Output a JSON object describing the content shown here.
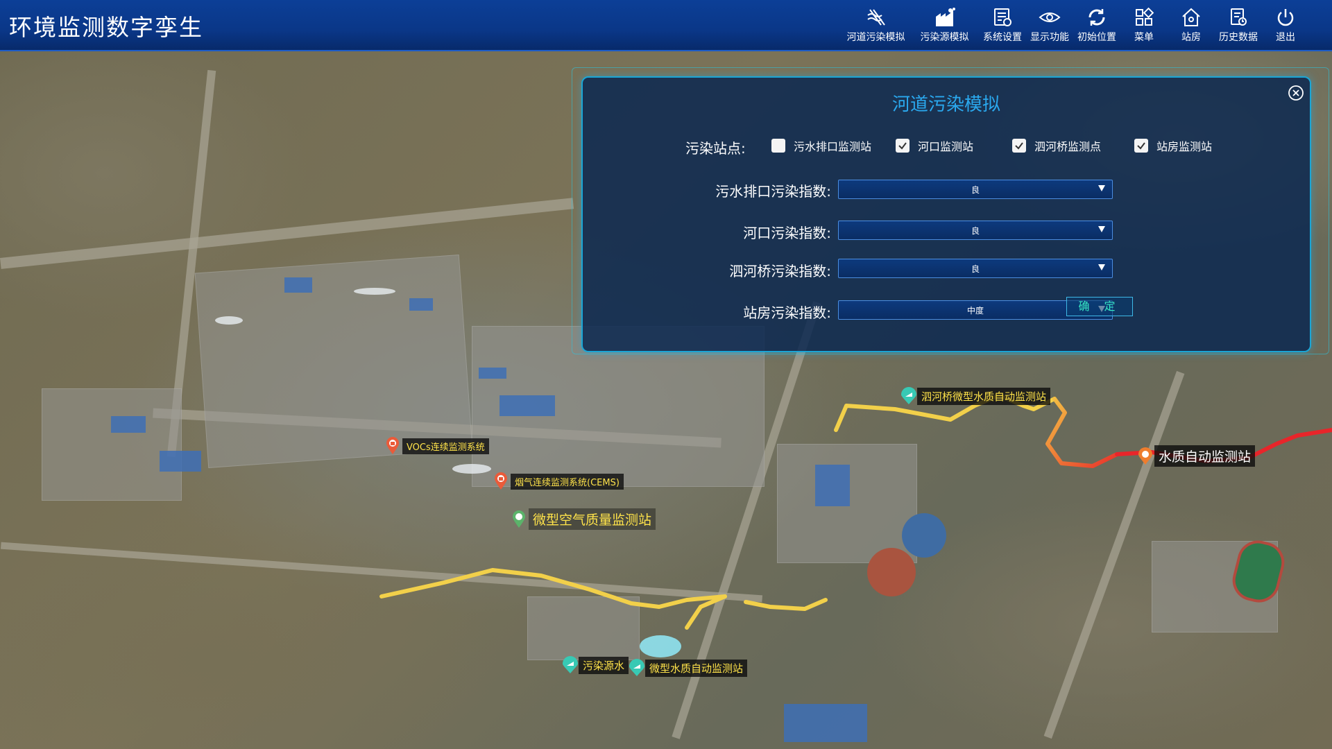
{
  "header": {
    "title": "环境监测数字孪生",
    "tools": [
      {
        "label": "河道污染模拟",
        "icon": "river-pollution-icon"
      },
      {
        "label": "污染源模拟",
        "icon": "factory-icon"
      },
      {
        "label": "系统设置",
        "icon": "settings-doc-icon"
      },
      {
        "label": "显示功能",
        "icon": "eye-icon"
      },
      {
        "label": "初始位置",
        "icon": "reset-icon"
      },
      {
        "label": "菜单",
        "icon": "grid-menu-icon"
      },
      {
        "label": "站房",
        "icon": "house-icon"
      },
      {
        "label": "历史数据",
        "icon": "history-doc-icon"
      },
      {
        "label": "退出",
        "icon": "power-icon"
      }
    ]
  },
  "dialog": {
    "title": "河道污染模拟",
    "stations_label": "污染站点:",
    "stations": [
      {
        "label": "污水排口监测站",
        "checked": false
      },
      {
        "label": "河口监测站",
        "checked": true
      },
      {
        "label": "泗河桥监测点",
        "checked": true
      },
      {
        "label": "站房监测站",
        "checked": true
      }
    ],
    "indices": [
      {
        "label": "污水排口污染指数:",
        "value": "良"
      },
      {
        "label": "河口污染指数:",
        "value": "良"
      },
      {
        "label": "泗河桥污染指数:",
        "value": "良"
      },
      {
        "label": "站房污染指数:",
        "value": "中度"
      }
    ],
    "confirm_label": "确 定"
  },
  "markers": {
    "vocs": "VOCs连续监测系统",
    "cems": "烟气连续监测系统(CEMS)",
    "air": "微型空气质量监测站",
    "sihe_bridge": "泗河桥微型水质自动监测站",
    "water_auto": "水质自动监测站",
    "pollution_source": "污染源水",
    "micro_water": "微型水质自动监测站"
  },
  "colors": {
    "header": "#0a3788",
    "dialog_border": "#1aa6d6",
    "dialog_title": "#2aa8ee",
    "marker_text": "#ffe34a",
    "river_yellow": "#f2d04a",
    "river_red": "#e8252a"
  }
}
